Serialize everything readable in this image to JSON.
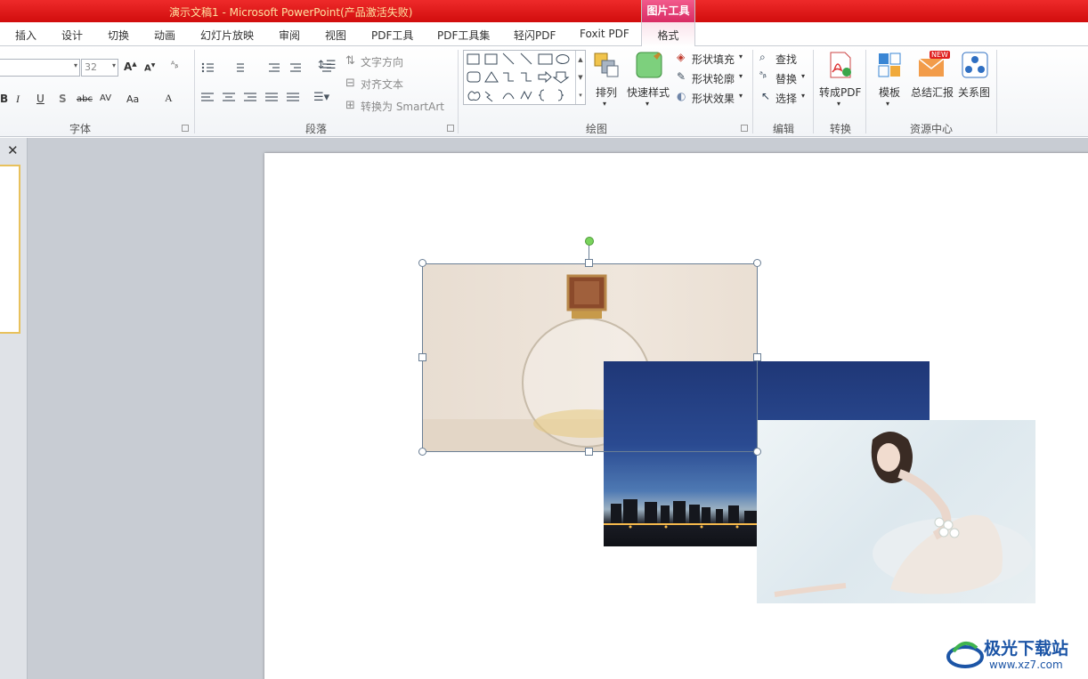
{
  "window": {
    "title": "演示文稿1 - Microsoft PowerPoint(产品激活失败)",
    "context_group": "图片工具"
  },
  "tabs": [
    "插入",
    "设计",
    "切换",
    "动画",
    "幻灯片放映",
    "审阅",
    "视图",
    "PDF工具",
    "PDF工具集",
    "轻闪PDF",
    "Foxit PDF"
  ],
  "context_tab": "格式",
  "ribbon": {
    "font": {
      "label": "字体",
      "size": "32",
      "buttons": [
        "B",
        "I",
        "U",
        "S",
        "abc",
        "AV",
        "Aa",
        "A"
      ]
    },
    "paragraph": {
      "label": "段落",
      "text_direction": "文字方向",
      "align_text": "对齐文本",
      "smartart": "转换为 SmartArt"
    },
    "drawing": {
      "label": "绘图",
      "arrange": "排列",
      "quick_styles": "快速样式",
      "shape_fill": "形状填充",
      "shape_outline": "形状轮廓",
      "shape_effects": "形状效果"
    },
    "editing": {
      "label": "编辑",
      "find": "查找",
      "replace": "替换",
      "select": "选择"
    },
    "convert": {
      "label": "转换",
      "to_pdf": "转成PDF"
    },
    "resources": {
      "label": "资源中心",
      "template": "模板",
      "summary": "总结汇报",
      "badge": "NEW",
      "relation": "关系图"
    }
  },
  "thumbnail_panel": {
    "close": "✕"
  },
  "watermark": {
    "name": "极光下载站",
    "url": "www.xz7.com"
  }
}
